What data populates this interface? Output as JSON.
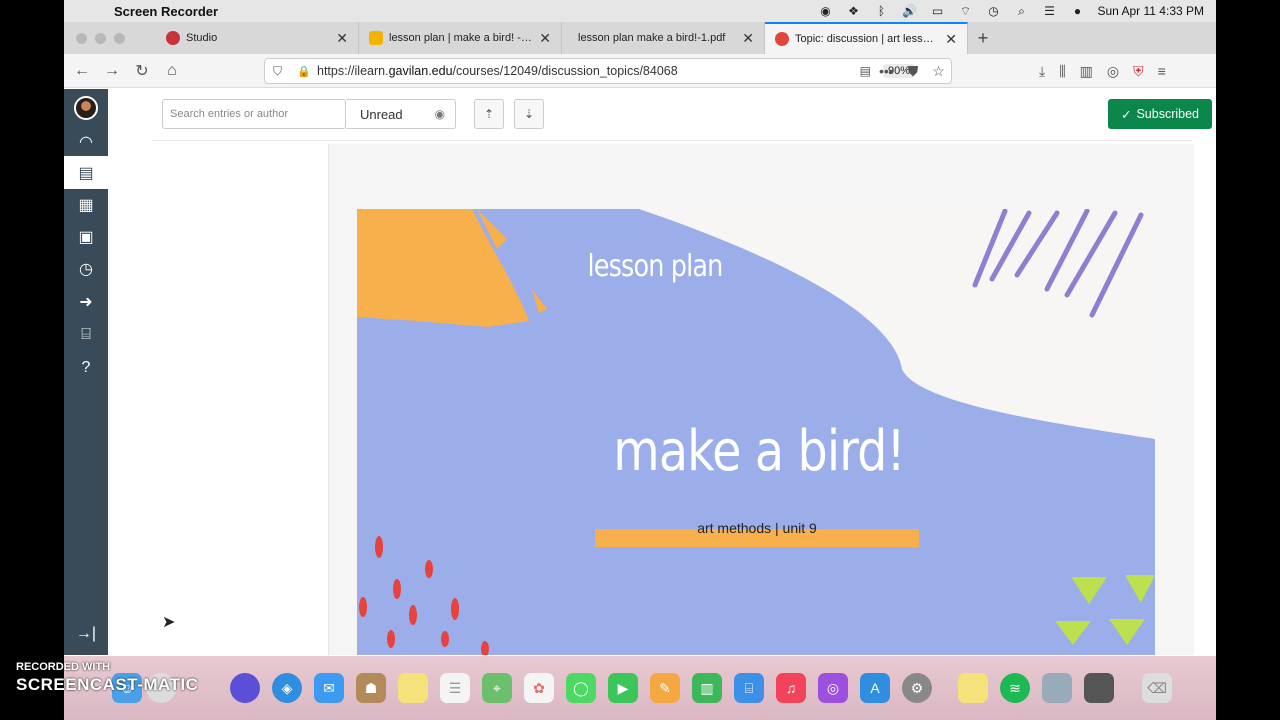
{
  "menubar": {
    "app_name": "Screen Recorder",
    "datetime": "Sun Apr 11  4:33 PM"
  },
  "tabs": [
    {
      "title": "Studio",
      "favicon_color": "#c8313a"
    },
    {
      "title": "lesson plan | make a bird! - Goo",
      "favicon_color": "#f2b400"
    },
    {
      "title": "lesson plan make a bird!-1.pdf",
      "favicon_color": "#dcdcdc"
    },
    {
      "title": "Topic: discussion | art lesson pl",
      "favicon_color": "#e0463a"
    }
  ],
  "address": {
    "url_prefix": "https://ilearn.",
    "url_domain": "gavilan.edu",
    "url_path": "/courses/12049/discussion_topics/84068",
    "zoom": "90%"
  },
  "toolbar": {
    "search_placeholder": "Search entries or author",
    "unread_label": "Unread",
    "subscribed_label": "Subscribed"
  },
  "slide": {
    "title_small": "lesson plan",
    "title_big": "make a bird!",
    "subtitle": "art methods | unit 9"
  },
  "watermark": {
    "line1": "RECORDED WITH",
    "line2": "SCREENCAST",
    "line2_suffix": "MATIC"
  },
  "colors": {
    "canvas_nav": "#394b58",
    "subscribed": "#0b874b",
    "slide_bg": "#9baeea",
    "slide_orange": "#f7b04b",
    "slide_cream": "#f8f6f4"
  }
}
